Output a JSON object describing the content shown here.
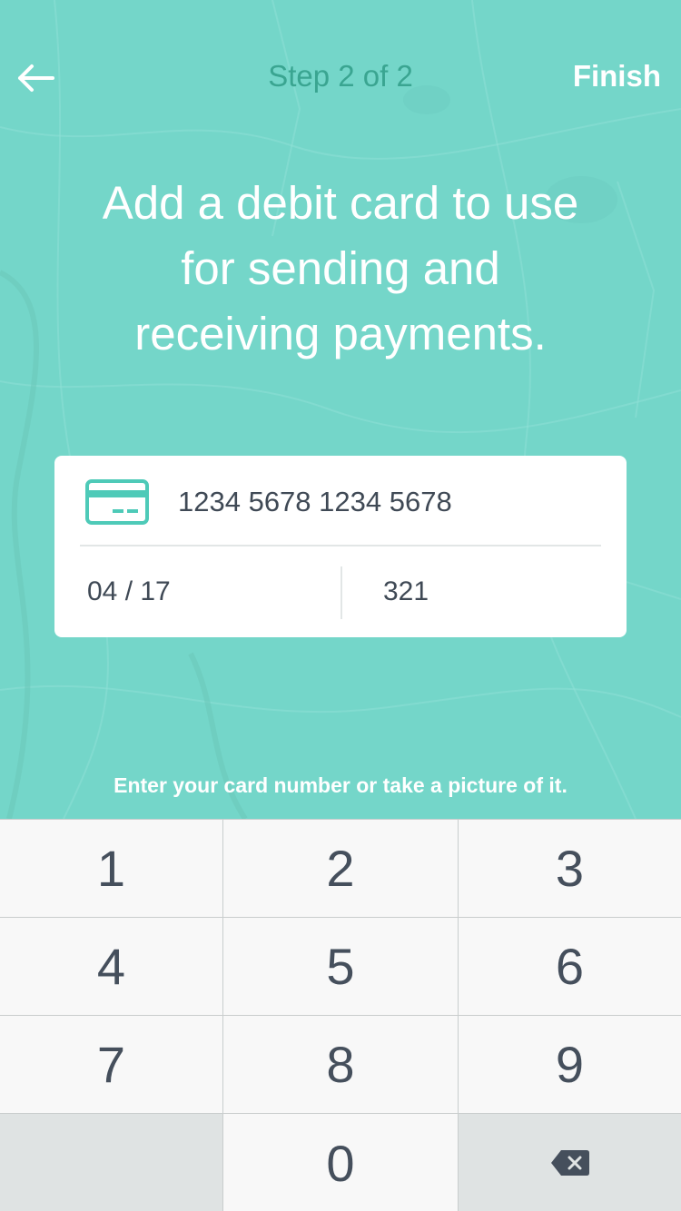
{
  "colors": {
    "background": "#74d6c9",
    "step_text": "#3aa591",
    "accent_icon": "#4ecab8",
    "text_dark": "#3f4955",
    "keypad_bg": "#f8f8f8",
    "keypad_dark": "#dfe3e3"
  },
  "header": {
    "back_icon": "arrow-left-icon",
    "step_label": "Step 2 of 2",
    "finish_label": "Finish"
  },
  "headline": {
    "line1": "Add a debit card to use",
    "line2": "for sending and",
    "line3": "receiving payments."
  },
  "card_form": {
    "card_icon": "credit-card-icon",
    "card_number": "1234 5678 1234 5678",
    "expiry": "04 / 17",
    "cvv": "321"
  },
  "hint": "Enter your card number or take a picture of it.",
  "keypad": {
    "keys": [
      "1",
      "2",
      "3",
      "4",
      "5",
      "6",
      "7",
      "8",
      "9",
      "",
      "0"
    ],
    "delete_icon": "backspace-icon"
  }
}
